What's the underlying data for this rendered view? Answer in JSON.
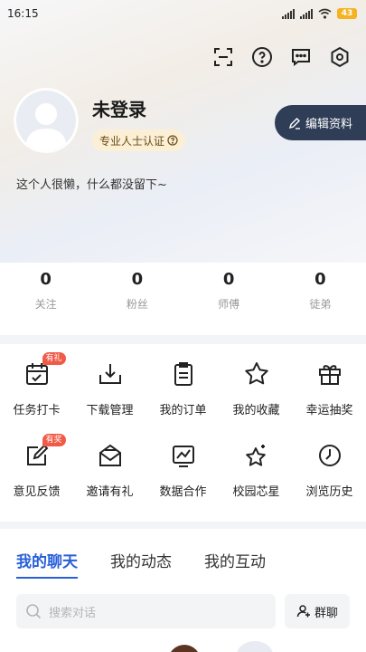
{
  "status_bar": {
    "time": "16:15",
    "battery": "43"
  },
  "header": {
    "icons": [
      "scan-icon",
      "help-icon",
      "message-icon",
      "settings-icon"
    ]
  },
  "profile": {
    "name": "未登录",
    "cert_label": "专业人士认证",
    "edit_label": "编辑资料",
    "bio": "这个人很懒，什么都没留下~"
  },
  "stats": [
    {
      "value": "0",
      "label": "关注"
    },
    {
      "value": "0",
      "label": "粉丝"
    },
    {
      "value": "0",
      "label": "师傅"
    },
    {
      "value": "0",
      "label": "徒弟"
    }
  ],
  "grid": [
    {
      "label": "任务打卡",
      "icon": "calendar-check-icon",
      "tag": "有礼"
    },
    {
      "label": "下载管理",
      "icon": "download-tray-icon"
    },
    {
      "label": "我的订单",
      "icon": "clipboard-icon"
    },
    {
      "label": "我的收藏",
      "icon": "star-icon"
    },
    {
      "label": "幸运抽奖",
      "icon": "gift-icon"
    },
    {
      "label": "意见反馈",
      "icon": "feedback-edit-icon",
      "tag": "有奖"
    },
    {
      "label": "邀请有礼",
      "icon": "envelope-icon"
    },
    {
      "label": "数据合作",
      "icon": "chart-icon"
    },
    {
      "label": "校园芯星",
      "icon": "sparkle-star-icon"
    },
    {
      "label": "浏览历史",
      "icon": "clock-icon"
    }
  ],
  "chat": {
    "tabs": [
      "我的聊天",
      "我的动态",
      "我的互动"
    ],
    "search_placeholder": "搜索对话",
    "group_label": "群聊"
  },
  "colors": {
    "accent": "#2860d8",
    "edit_bg": "#2f3e56",
    "tag": "#ef5b47",
    "badge_bg": "#fbefd6"
  }
}
